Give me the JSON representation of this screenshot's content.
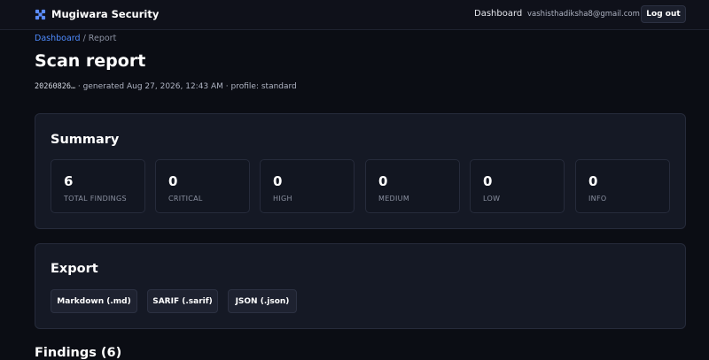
{
  "header": {
    "brand": "Mugiwara Security",
    "nav_dashboard": "Dashboard",
    "user_email": "vashisthadiksha8@gmail.com",
    "logout_label": "Log out"
  },
  "breadcrumb": {
    "link": "Dashboard",
    "separator": " / ",
    "current": "Report"
  },
  "page": {
    "title": "Scan report",
    "scan_id": "20260826…",
    "meta": " · generated Aug 27, 2026, 12:43 AM · profile: standard"
  },
  "summary": {
    "title": "Summary",
    "stats": [
      {
        "value": "6",
        "label": "TOTAL FINDINGS"
      },
      {
        "value": "0",
        "label": "CRITICAL"
      },
      {
        "value": "0",
        "label": "HIGH"
      },
      {
        "value": "0",
        "label": "MEDIUM"
      },
      {
        "value": "0",
        "label": "LOW"
      },
      {
        "value": "0",
        "label": "INFO"
      }
    ]
  },
  "export": {
    "title": "Export",
    "buttons": [
      "Markdown (.md)",
      "SARIF (.sarif)",
      "JSON (.json)"
    ]
  },
  "findings": {
    "title": "Findings (6)"
  },
  "colors": {
    "background": "#0b0d14",
    "card": "#151925",
    "accent_link": "#4f8cff",
    "brand_icon": "#5b8cff"
  },
  "icons": {
    "brand": "brand-logo-icon"
  }
}
